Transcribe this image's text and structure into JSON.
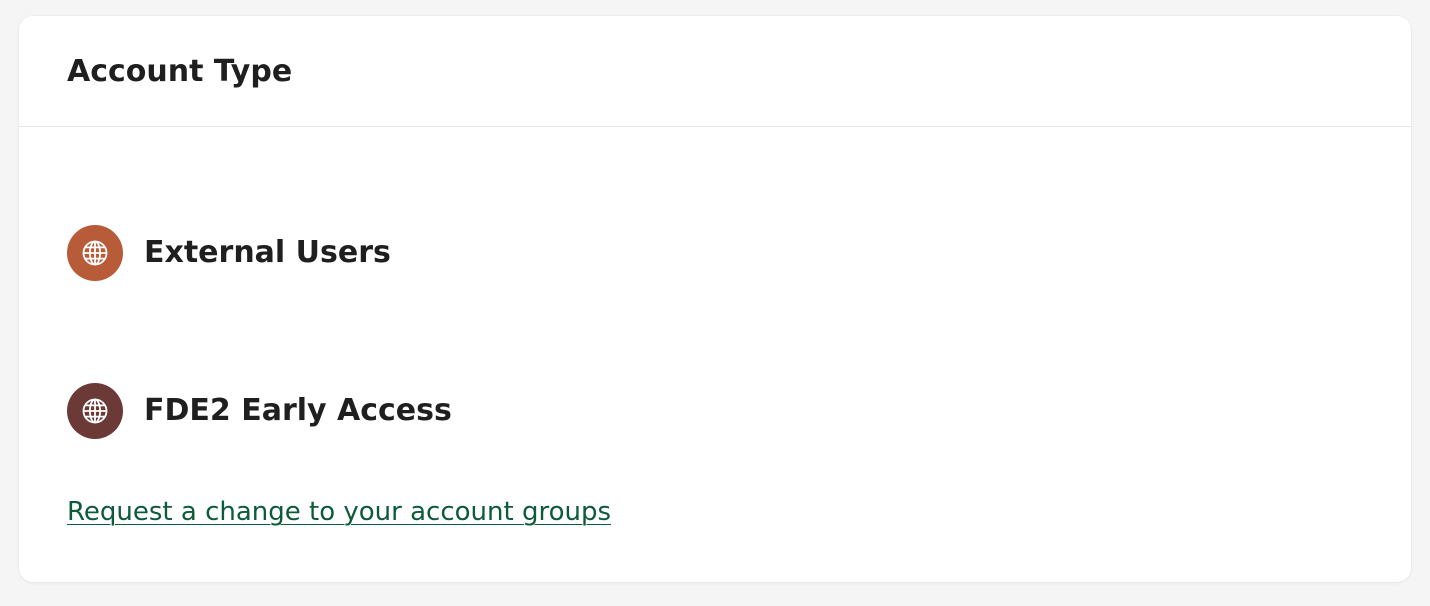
{
  "card": {
    "title": "Account Type"
  },
  "groups": [
    {
      "label": "External Users",
      "icon": "globe-icon",
      "icon_color": "#b85b39"
    },
    {
      "label": "FDE2 Early Access",
      "icon": "globe-icon",
      "icon_color": "#6b3a37"
    }
  ],
  "actions": {
    "request_change_label": "Request a change to your account groups"
  },
  "colors": {
    "page_background": "#f4f5f4",
    "card_background": "#ffffff",
    "link": "#0d5b3a",
    "text": "#1f1f1f"
  }
}
